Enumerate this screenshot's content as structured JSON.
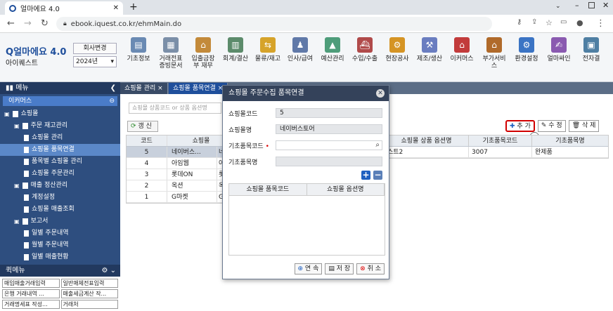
{
  "browser": {
    "tab_title": "얼마에요 4.0",
    "url": "ebook.iquest.co.kr/ehmMain.do"
  },
  "app": {
    "logo": "얼마에요 4.0",
    "company": "아이퀘스트",
    "change_company_label": "회사변경",
    "year": "2024년"
  },
  "menu": [
    "기초정보",
    "거래전표 증빙문서",
    "입출금장부 재무",
    "회계/결산",
    "물류/재고",
    "인사/급여",
    "예산관리",
    "수입/수출",
    "현장공사",
    "제조/생산",
    "이커머스",
    "부가서비스",
    "환경설정",
    "얼마싸인",
    "전자결"
  ],
  "sidebar": {
    "header": "메뉴",
    "section": "이커머스",
    "tree": [
      {
        "label": "쇼핑몰",
        "level": 0,
        "type": "folder"
      },
      {
        "label": "주문 재고관리",
        "level": 1,
        "type": "folder"
      },
      {
        "label": "쇼핑몰 관리",
        "level": 2,
        "type": "doc"
      },
      {
        "label": "쇼핑몰 품목연결",
        "level": 2,
        "type": "doc",
        "selected": true
      },
      {
        "label": "품목별 쇼핑몰 관리",
        "level": 2,
        "type": "doc"
      },
      {
        "label": "쇼핑몰 주문관리",
        "level": 2,
        "type": "doc"
      },
      {
        "label": "매출 정산관리",
        "level": 1,
        "type": "folder"
      },
      {
        "label": "계정설정",
        "level": 2,
        "type": "doc"
      },
      {
        "label": "쇼핑몰 매출조회",
        "level": 2,
        "type": "doc"
      },
      {
        "label": "보고서",
        "level": 1,
        "type": "folder"
      },
      {
        "label": "일별 주문내역",
        "level": 2,
        "type": "doc"
      },
      {
        "label": "월별 주문내역",
        "level": 2,
        "type": "doc"
      },
      {
        "label": "일별 매출현황",
        "level": 2,
        "type": "doc"
      }
    ]
  },
  "quick_menu": {
    "header": "퀵메뉴",
    "items": [
      "매입매출거래입력",
      "일반매체전표입력",
      "은행 거래내역 ...",
      "매출세금계산 작...",
      "거래명세표 작성...",
      "거래처"
    ]
  },
  "content_tabs": [
    "쇼핑몰 관리",
    "쇼핑몰 품목연결"
  ],
  "content": {
    "search_placeholder": "쇼핑몰 상품코드 or 상품 옵션명",
    "refresh_label": "갱 신",
    "left_columns": [
      "코드",
      "쇼핑몰"
    ],
    "left_rows": [
      {
        "code": "5",
        "mall": "네이버스...",
        "extra": "네이",
        "selected": true
      },
      {
        "code": "4",
        "mall": "아임웹",
        "extra": "아임"
      },
      {
        "code": "3",
        "mall": "롯데ON",
        "extra": "롯데"
      },
      {
        "code": "2",
        "mall": "옥션",
        "extra": "옥션"
      },
      {
        "code": "1",
        "mall": "G마켓",
        "extra": "G마"
      }
    ],
    "buttons": {
      "add": "추 가",
      "edit": "수 정",
      "delete": "삭 제"
    },
    "right_columns": [
      "쇼핑몰 상품 옵션명",
      "기초품목코드",
      "기초품목명"
    ],
    "right_rows": [
      {
        "option": "스트2",
        "item_code": "3007",
        "item_name": "완제품"
      }
    ]
  },
  "modal": {
    "title": "쇼핑몰 주문수집 품목연결",
    "fields": [
      {
        "label": "쇼핑몰코드",
        "value": "5"
      },
      {
        "label": "쇼핑몰명",
        "value": "네이버스토어"
      },
      {
        "label": "기초품목코드",
        "value": "",
        "required": true
      },
      {
        "label": "기초품목명",
        "value": ""
      }
    ],
    "grid_columns": [
      "쇼핑몰 품목코드",
      "쇼핑몰 옵션명"
    ],
    "buttons": {
      "continue": "연 속",
      "save": "저 장",
      "cancel": "취 소"
    }
  }
}
